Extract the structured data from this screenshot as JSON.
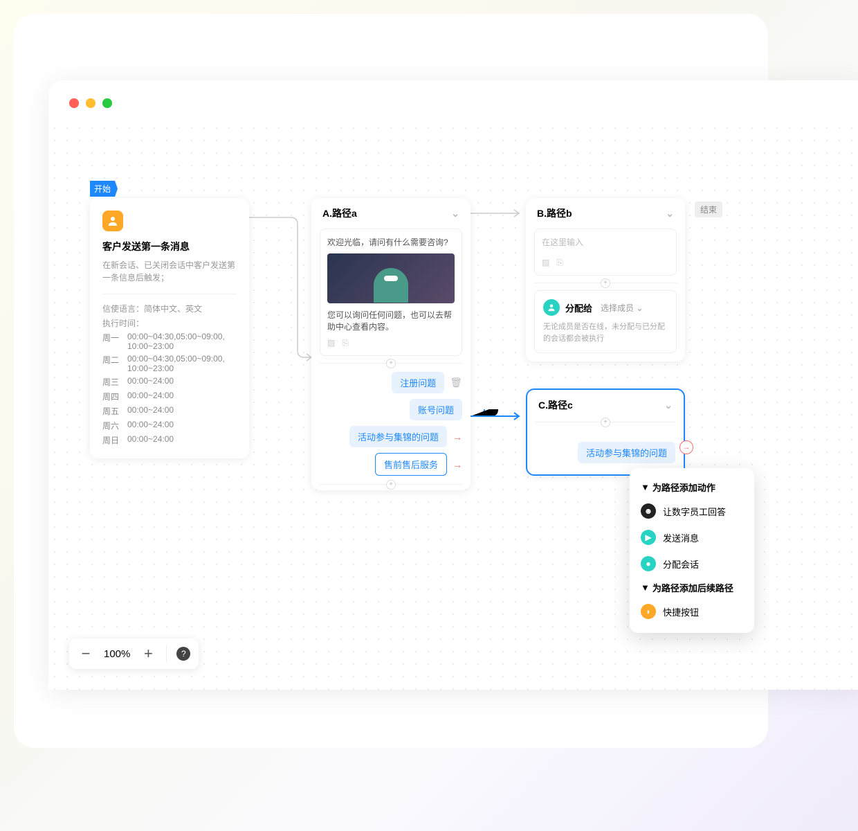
{
  "start_label": "开始",
  "end_label": "结束",
  "trigger": {
    "title": "客户发送第一条消息",
    "description": "在新会话、已关闭会话中客户发送第一条信息后触发；",
    "lang_label": "信使语言：",
    "lang_value": "简体中文、英文",
    "time_label": "执行时间：",
    "schedule": [
      {
        "day": "周一",
        "time": "00:00~04:30,05:00~09:00, 10:00~23:00"
      },
      {
        "day": "周二",
        "time": "00:00~04:30,05:00~09:00, 10:00~23:00"
      },
      {
        "day": "周三",
        "time": "00:00~24:00"
      },
      {
        "day": "周四",
        "time": "00:00~24:00"
      },
      {
        "day": "周五",
        "time": "00:00~24:00"
      },
      {
        "day": "周六",
        "time": "00:00~24:00"
      },
      {
        "day": "周日",
        "time": "00:00~24:00"
      }
    ]
  },
  "path_a": {
    "title": "A.路径a",
    "greeting": "欢迎光临，请问有什么需要咨询?",
    "helptext": "您可以询问任何问题，也可以去帮助中心查看内容。",
    "buttons": {
      "register": "注册问题",
      "account": "账号问题",
      "activity": "活动参与集锦的问题",
      "service": "售前售后服务"
    }
  },
  "path_b": {
    "title": "B.路径b",
    "placeholder": "在这里输入",
    "assign_label": "分配给",
    "select_member": "选择成员",
    "assign_desc": "无论成员是否在线，未分配与已分配的会话都会被执行"
  },
  "path_c": {
    "title": "C.路径c",
    "button": "活动参与集锦的问题"
  },
  "menu": {
    "section1": "为路径添加动作",
    "item1": "让数字员工回答",
    "item2": "发送消息",
    "item3": "分配会话",
    "section2": "为路径添加后续路径",
    "item4": "快捷按钮"
  },
  "zoom": {
    "level": "100%"
  }
}
